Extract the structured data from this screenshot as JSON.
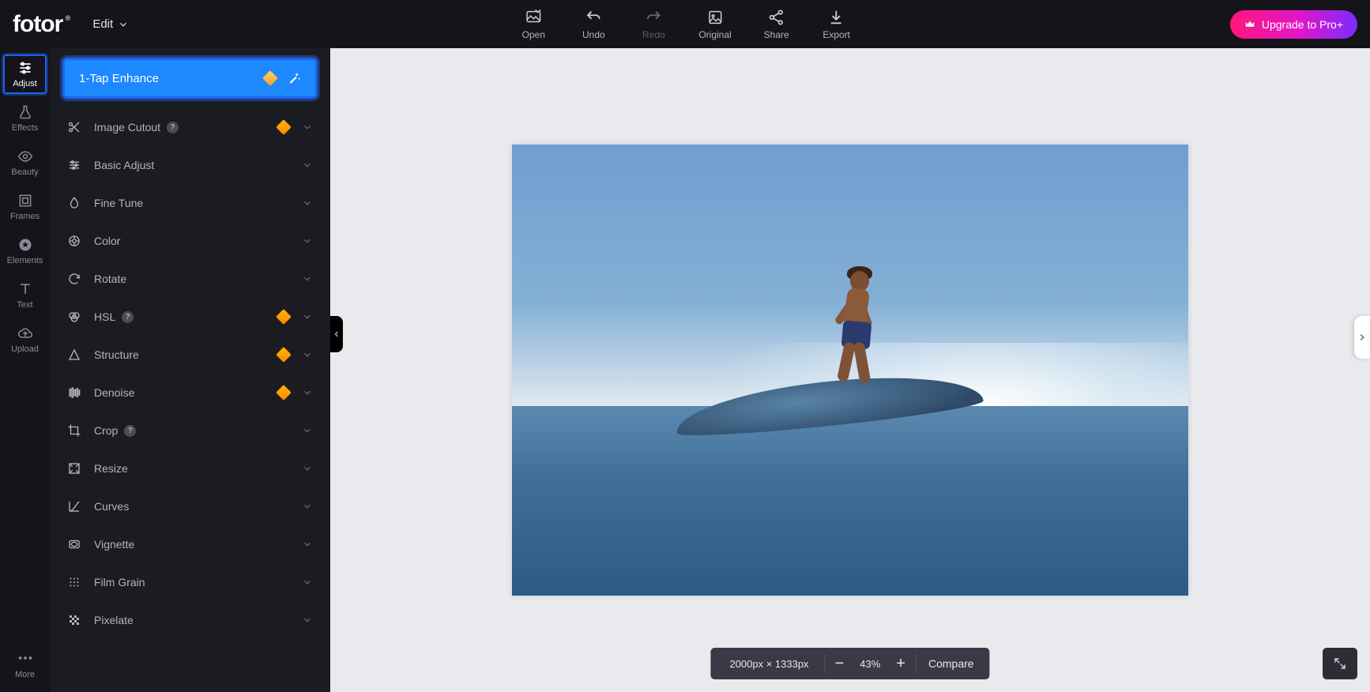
{
  "brand": "fotor",
  "edit_menu": "Edit",
  "topbar": {
    "open": "Open",
    "undo": "Undo",
    "redo": "Redo",
    "original": "Original",
    "share": "Share",
    "export": "Export"
  },
  "upgrade": "Upgrade to Pro+",
  "rail": {
    "adjust": "Adjust",
    "effects": "Effects",
    "beauty": "Beauty",
    "frames": "Frames",
    "elements": "Elements",
    "text": "Text",
    "upload": "Upload",
    "more": "More"
  },
  "panel": {
    "enhance": "1-Tap Enhance",
    "image_cutout": "Image Cutout",
    "basic_adjust": "Basic Adjust",
    "fine_tune": "Fine Tune",
    "color": "Color",
    "rotate": "Rotate",
    "hsl": "HSL",
    "structure": "Structure",
    "denoise": "Denoise",
    "crop": "Crop",
    "resize": "Resize",
    "curves": "Curves",
    "vignette": "Vignette",
    "film_grain": "Film Grain",
    "pixelate": "Pixelate"
  },
  "status": {
    "dimensions": "2000px × 1333px",
    "zoom": "43%",
    "compare": "Compare"
  }
}
